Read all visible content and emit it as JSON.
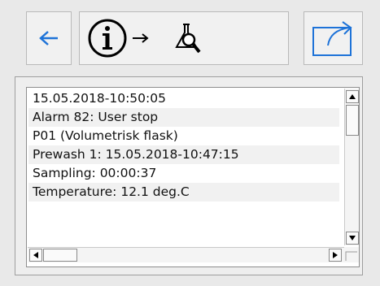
{
  "toolbar": {
    "back_icon": "arrow-left-icon",
    "info_icon": "info-circle-icon",
    "arrow_icon": "arrow-right-icon",
    "flask_search_icon": "flask-search-icon",
    "export_icon": "export-icon",
    "accent_color": "#1e73d8"
  },
  "log": {
    "rows": [
      "15.05.2018-10:50:05",
      "Alarm 82: User stop",
      "P01 (Volumetrisk flask)",
      "Prewash 1: 15.05.2018-10:47:15",
      "Sampling: 00:00:37",
      "Temperature: 12.1 deg.C"
    ]
  }
}
